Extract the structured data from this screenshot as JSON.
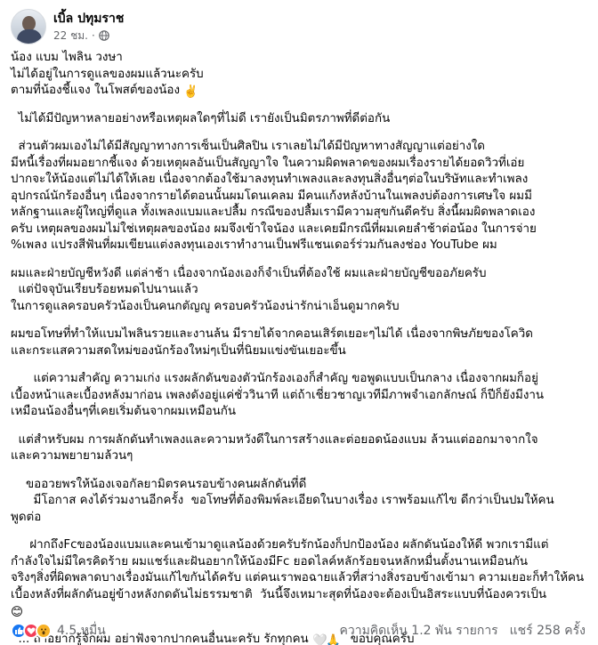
{
  "post": {
    "author": "เบิ้ล ปทุมราช",
    "time": "22 ชม.",
    "time_sep": "·",
    "privacy_icon": "globe-icon",
    "paragraphs": [
      "น้อง แบม ไพลิน วงษา\nไม่ได้อยู่ในการดูแลของผมแล้วนะครับ\nตามที่น้องชี้แจง ในโพสต์ของน้อง",
      "  ไม่ได้มีปัญหาหลายอย่างหรือเหตุผลใดๆที่ไม่ดี เรายังเป็นมิตรภาพที่ดีต่อกัน",
      "  ส่วนตัวผมเองไม่ได้มีสัญญาทางการเซ็นเป็นศิลปิน เราเลยไม่ได้มีปัญหาทางสัญญาแต่อย่างใด\nมีหนี้เรื่องที่ผมอยากชี้แจง ด้วยเหตุผลอันเป็นสัญญาใจ ในความผิดพลาดของผมเรื่องรายได้ยอดวิวที่เอ่ย\nปากจะให้น้องแต่ไม่ได้ให้เลย เนื่องจากต้องใช้มาลงทุนทำเพลงและลงทุนสิ่งอื่นๆต่อในบริษัทและทำเพลง\nอุปกรณ์นักร้องอื่นๆ เนื่องจากรายได้ตอนนั้นผมโดนเคลม มีคนแก้งหลังบ้านในเพลงบ่ต้องการเศษใจ ผมมี\nหลักฐานและผู้ใหญ่ที่ดูแล ทั้งเพลงแบมและปลื้ม กรณีของปลื้มเรามีความสุขกันดีครับ สิ่งนี้ผมผิดพลาดเอง\nครับ เหตุผลของผมไม่ใช่เหตุผลของน้อง ผมจึงเข้าใจน้อง และเคยมีกรณีที่ผมเคยลำช้าต่อน้อง ในการจ่าย\n%เพลง แปรงสีฟันที่ผมเขียนแต่งลงทุนเองเราทำงานเป็นฟรีแชนเดอร์ร่วมกันลงช่อง YouTube ผม",
      "ผมและฝ่ายบัญชีหวังดี แต่ล่าช้า เนื่องจากน้องเองก็จำเป็นที่ต้องใช้ ผมและฝ่ายบัญชีขออภัยครับ\n  แต่ปัจจุบันเรียบร้อยหมดไปนานแล้ว\nในการดูแลครอบครัวน้องเป็นคนกตัญญู ครอบครัวน้องน่ารักน่าเอ็นดูมากครับ",
      "ผมขอโทษที่ทำให้แบมไพลินรวยและงานล้น มีรายได้จากคอนเสิร์ตเยอะๆไม่ได้ เนื่องจากพิษภัยของโควิด\nและกระแสความสดใหม่ของนักร้องใหม่ๆเป็นที่นิยมแข่งขันเยอะขึ้น",
      "      แต่ความสำคัญ ความเก่ง แรงผลักดันของตัวนักร้องเองก็สำคัญ ขอพูดแบบเป็นกลาง เนื่องจากผมก็อยู่\nเบื้องหน้าและเบื้องหลังมาก่อน เพลงดังอยู่แค่ชั่ววินาที แต่ถ้าเชี่ยวชาญเวทีมีภาพจำเอกลักษณ์ ก็ปีก็ยังมีงาน\nเหมือนน้องอื่นๆที่เคยเริ่มต้นจากผมเหมือนกัน",
      "  แต่สำหรับผม การผลักดันทำเพลงและความหวังดีในการสร้างและต่อยอดน้องแบม ล้วนแต่ออกมาจากใจ\nและความพยายามล้วนๆ",
      "    ขออวยพรให้น้องเจอกัลยามิตรคนรอบข้างคนผลักดันที่ดี\n      มีโอกาส คงได้ร่วมงานอีกครั้ง  ขอโทษที่ต้องพิมพ์ละเอียดในบางเรื่อง เราพร้อมแก้ไข ดีกว่าเป็นปมให้คน\nพูดต่อ",
      "     ฝากถึงFcของน้องแบมและคนเข้ามาดูแลน้องด้วยครับรักน้องก็ปกป้องน้อง ผลักดันน้องให้ดี พวกเรามีแต่\nกำลังใจไม่มีใครคิดร้าย ผมแชร์และฝันอยากให้น้องมีFc ยอดไลค์หลักร้อยจนหลักหมื่นตั้งนานเหมือนกัน\nจริงๆสิ่งที่ผิดพลาดบางเรื่องมันแก้ไขกันได้ครับ แต่คนเราพอฉายแล้วที่สว่างสิ่งรอบข้างเข้ามา ความเยอะก็ทำให้คน\nเบื้องหลังที่ผลักดันอยู่ข้างหลังกดดันไม่ธรรมชาติ  วันนี้จึงเหมาะสุดที่น้องจะต้องเป็นอิสระแบบที่น้องควรเป็น",
      "  ... ถ้าอยากรู้จักผม อย่าฟังจากปากคนอื่นนะครับ รักทุกคน   ขอบคุณครับ"
    ],
    "emojis": {
      "peace": "✌️",
      "smile": "😊",
      "heart": "🤍",
      "pray": "🙏"
    },
    "reactions": {
      "types": [
        "like",
        "love",
        "wow"
      ],
      "count": "4.5 หมื่น"
    },
    "stats": {
      "comments": "ความคิดเห็น 1.2 พัน รายการ",
      "shares": "แชร์ 258 ครั้ง"
    }
  }
}
